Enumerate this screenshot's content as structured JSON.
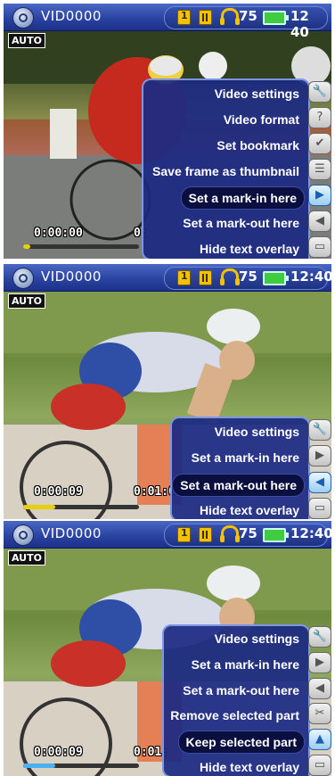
{
  "screens": [
    {
      "status": {
        "title": "VID0000",
        "volume": "75",
        "time": "12 40"
      },
      "auto_label": "AUTO",
      "timecodes": {
        "left": "0:00:00",
        "right": "0:"
      },
      "progress": 0.06,
      "progress_color": "#e8d000",
      "menu": [
        {
          "label": "Video settings",
          "icon": "wrench-icon",
          "selected": false
        },
        {
          "label": "Video format",
          "icon": "question-icon",
          "selected": false
        },
        {
          "label": "Set bookmark",
          "icon": "check-icon",
          "selected": false
        },
        {
          "label": "Save frame as thumbnail",
          "icon": "document-icon",
          "selected": false
        },
        {
          "label": "Set a mark-in here",
          "icon": "arrow-right-icon",
          "selected": true
        },
        {
          "label": "Set a mark-out here",
          "icon": "arrow-left-icon",
          "selected": false
        },
        {
          "label": "Hide text overlay",
          "icon": "overlay-icon",
          "selected": false
        }
      ]
    },
    {
      "status": {
        "title": "VID0000",
        "volume": "75",
        "time": "12:40"
      },
      "auto_label": "AUTO",
      "timecodes": {
        "left": "0:00:09",
        "right": "0:01:0"
      },
      "progress": 0.28,
      "progress_color": "#e8d000",
      "menu": [
        {
          "label": "Video settings",
          "icon": "wrench-icon",
          "selected": false
        },
        {
          "label": "Set a mark-in here",
          "icon": "arrow-right-icon",
          "selected": false
        },
        {
          "label": "Set a mark-out here",
          "icon": "arrow-left-icon",
          "selected": true
        },
        {
          "label": "Hide text overlay",
          "icon": "overlay-icon",
          "selected": false
        }
      ]
    },
    {
      "status": {
        "title": "VID0000",
        "volume": "75",
        "time": "12:40"
      },
      "auto_label": "AUTO",
      "timecodes": {
        "left": "0:00:09",
        "right": "0:01:"
      },
      "progress": 0.28,
      "progress_color": "#4ab0f0",
      "menu": [
        {
          "label": "Video settings",
          "icon": "wrench-icon",
          "selected": false
        },
        {
          "label": "Set a mark-in here",
          "icon": "arrow-right-icon",
          "selected": false
        },
        {
          "label": "Set a mark-out here",
          "icon": "arrow-left-icon",
          "selected": false
        },
        {
          "label": "Remove selected part",
          "icon": "scissors-icon",
          "selected": false
        },
        {
          "label": "Keep selected part",
          "icon": "keep-icon",
          "selected": true
        },
        {
          "label": "Hide text overlay",
          "icon": "overlay-icon",
          "selected": false
        }
      ]
    }
  ]
}
